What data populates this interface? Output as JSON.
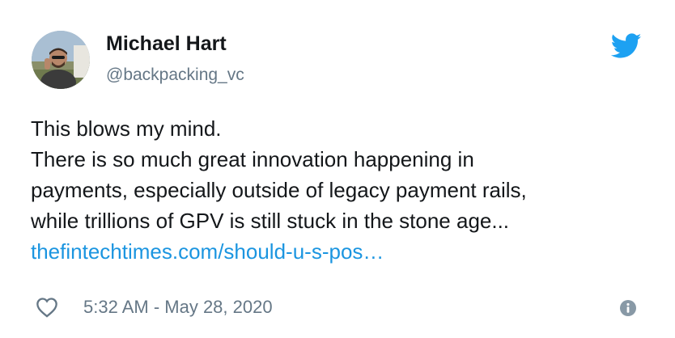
{
  "author": {
    "display_name": "Michael Hart",
    "handle": "@backpacking_vc",
    "avatar_icon": "profile-photo"
  },
  "brand": {
    "icon": "twitter-bird-icon",
    "color": "#1da1f2"
  },
  "tweet": {
    "lines": [
      "This blows my mind.",
      "There is so much great innovation happening in",
      "payments, especially outside of legacy payment rails,",
      "while trillions of GPV is still stuck in the stone age..."
    ],
    "link_text": "thefintechtimes.com/should-u-s-pos…",
    "link_color": "#1b95e0"
  },
  "footer": {
    "like_icon": "heart-icon",
    "timestamp": "5:32 AM - May 28, 2020",
    "info_icon": "info-icon"
  }
}
